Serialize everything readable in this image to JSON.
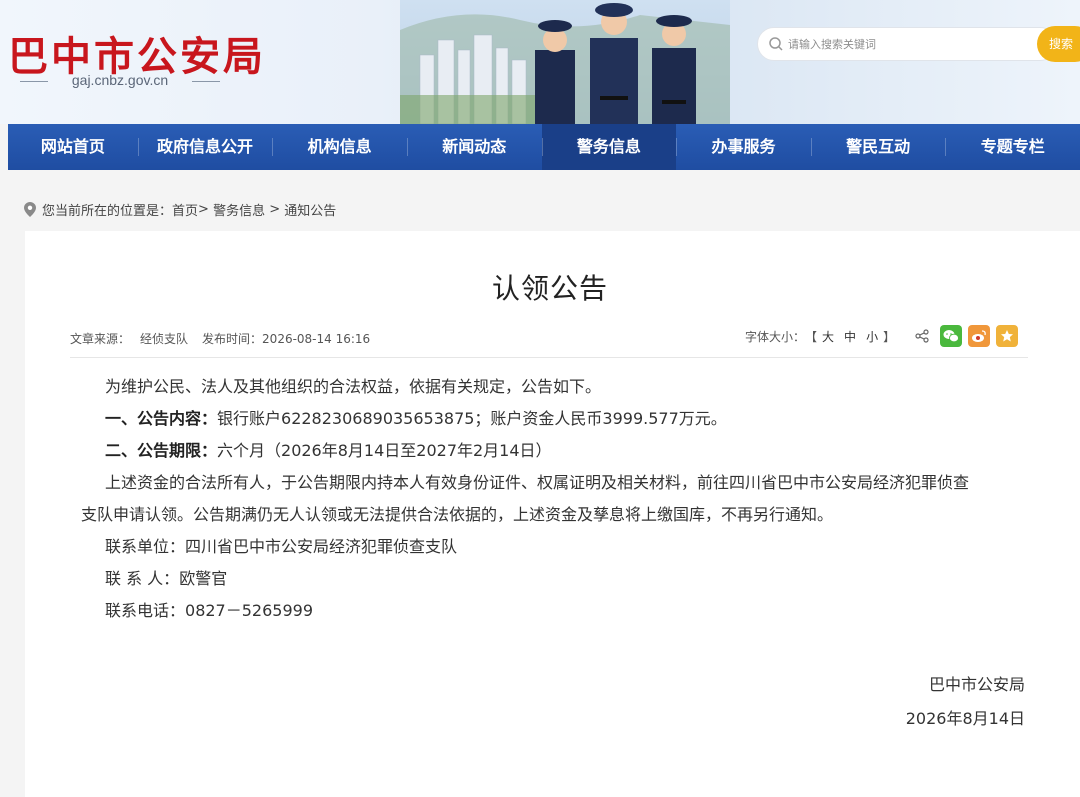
{
  "site": {
    "title": "巴中市公安局",
    "domain": "gaj.cnbz.gov.cn"
  },
  "search": {
    "placeholder": "请输入搜索关键词",
    "button": "搜索"
  },
  "nav": [
    {
      "label": "网站首页",
      "active": false
    },
    {
      "label": "政府信息公开",
      "active": false
    },
    {
      "label": "机构信息",
      "active": false
    },
    {
      "label": "新闻动态",
      "active": false
    },
    {
      "label": "警务信息",
      "active": true
    },
    {
      "label": "办事服务",
      "active": false
    },
    {
      "label": "警民互动",
      "active": false
    },
    {
      "label": "专题专栏",
      "active": false
    }
  ],
  "breadcrumb": {
    "prefix": "您当前所在的位置是：",
    "home": "首页",
    "sep1": ">",
    "level1": "警务信息",
    "sep2": ">",
    "level2": "通知公告"
  },
  "article": {
    "title": "认领公告",
    "source_label": "文章来源：",
    "source": "经侦支队",
    "date_label": "发布时间：",
    "date": "2026-08-14 16:16",
    "font_size_label": "字体大小：",
    "font_bracket_open": "【",
    "font_large": "大",
    "font_medium": "中",
    "font_small": "小",
    "font_bracket_close": "】",
    "intro": "为维护公民、法人及其他组织的合法权益，依据有关规定，公告如下。",
    "item1_label": "一、公告内容：",
    "item1_text": "银行账户6228230689035653875；账户资金人民币3999.577万元。",
    "item2_label": "二、公告期限：",
    "item2_text": "六个月（2026年8月14日至2027年2月14日）",
    "body_line1": "上述资金的合法所有人，于公告期限内持本人有效身份证件、权属证明及相关材料，前往四川省巴中市公安局经济犯罪侦查",
    "body_line2": "支队申请认领。公告期满仍无人认领或无法提供合法依据的，上述资金及孳息将上缴国库，不再另行通知。",
    "contact_unit_label": "联系单位：",
    "contact_unit": "四川省巴中市公安局经济犯罪侦查支队",
    "contact_person_label": "联 系 人：",
    "contact_person": "欧警官",
    "contact_phone_label": "联系电话：",
    "contact_phone": "0827－5265999",
    "sign_org": "巴中市公安局",
    "sign_date": "2026年8月14日"
  },
  "colors": {
    "brand_red": "#c8161d",
    "nav_blue": "#2a5db5",
    "nav_active": "#1a3f88",
    "search_button": "#f2b418"
  }
}
